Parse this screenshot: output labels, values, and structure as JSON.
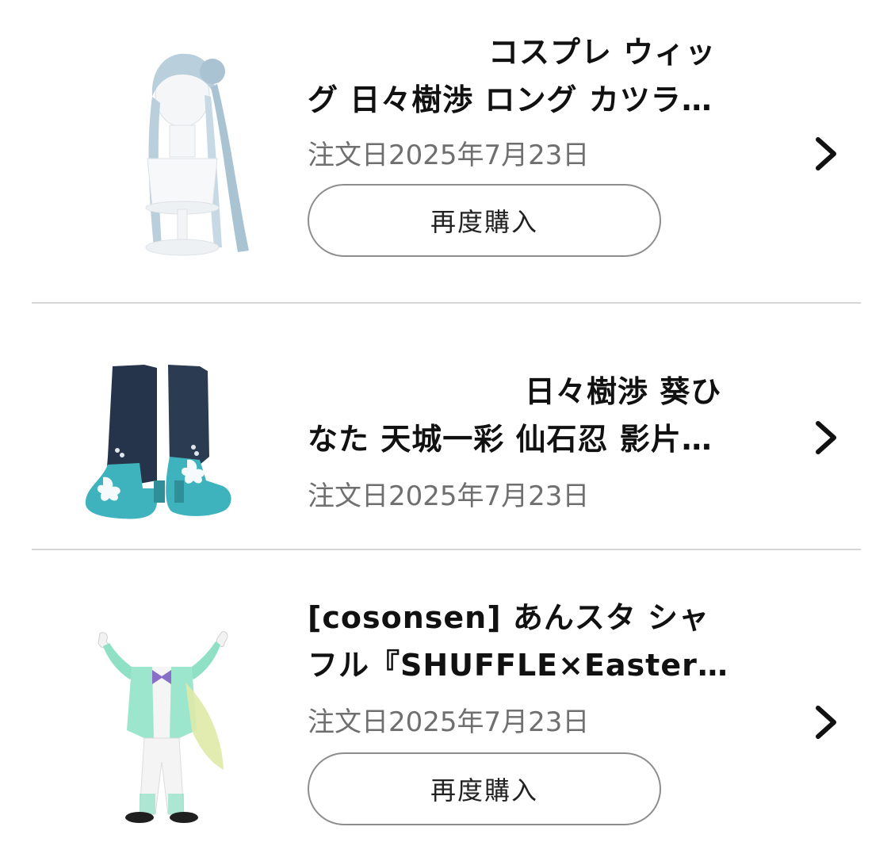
{
  "orders": [
    {
      "title_line1": "コスプレ ウィッ",
      "title_line2": "グ 日々樹渉 ロング カツラ…",
      "date": "注文日2025年7月23日",
      "rebuy_label": "再度購入",
      "thumbnail": "wig-product-image"
    },
    {
      "title_line1": "日々樹渉 葵ひ",
      "title_line2": "なた 天城一彩 仙石忍 影片…",
      "date": "注文日2025年7月23日",
      "thumbnail": "boots-product-image"
    },
    {
      "title_line1": "[cosonsen] あんスタ シャ",
      "title_line2": "フル『SHUFFLE×Easter…",
      "date": "注文日2025年7月23日",
      "rebuy_label": "再度購入",
      "thumbnail": "costume-product-image"
    }
  ],
  "icons": {
    "row_arrow": "chevron-right-icon"
  },
  "colors": {
    "text": "#111111",
    "date_text": "#6f6f6f",
    "button_border": "#8d8d8d",
    "divider": "#d6d6d6",
    "wig": "#b9cfdc",
    "boot_dark": "#25344a",
    "boot_teal": "#3fb3bd",
    "costume_mint": "#8fe0c4"
  }
}
